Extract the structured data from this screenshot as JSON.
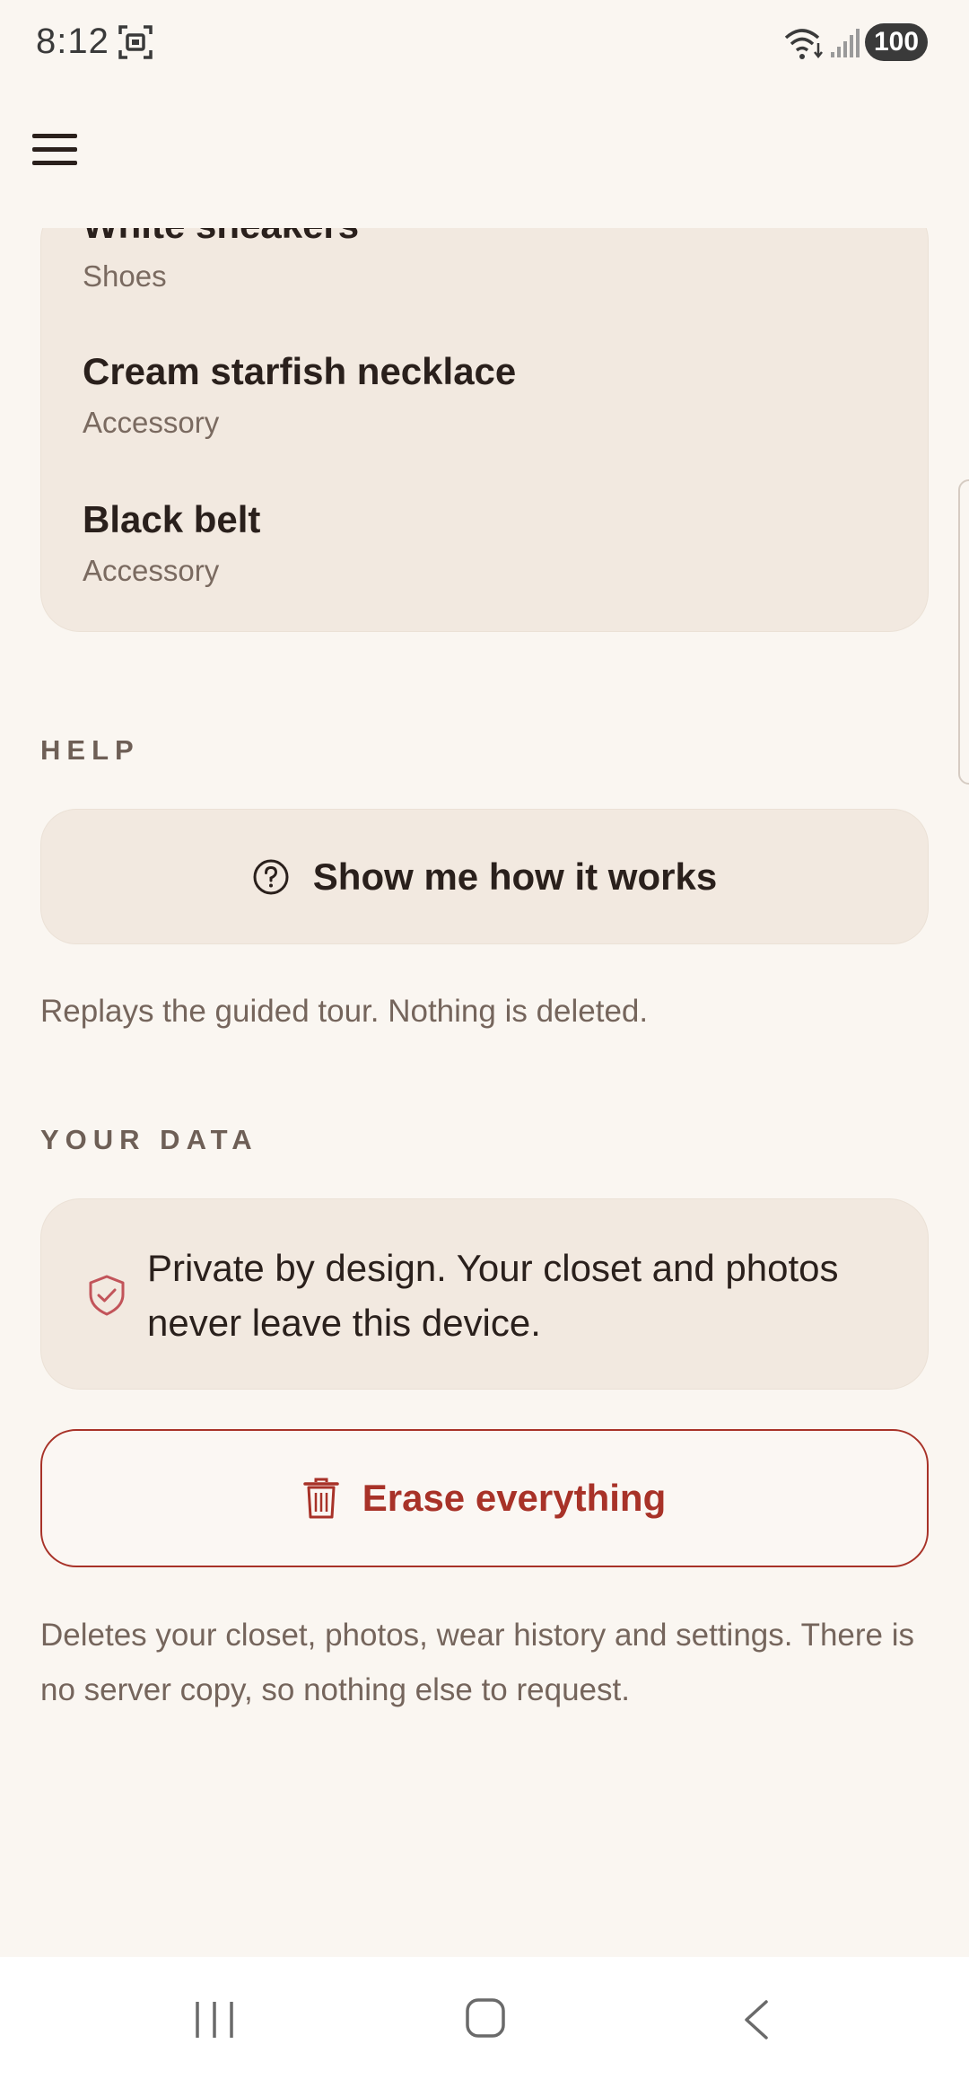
{
  "status_bar": {
    "time": "8:12",
    "battery": "100"
  },
  "app_bar": {
    "menu_icon": "hamburger-menu-icon"
  },
  "items": [
    {
      "name": "White sneakers",
      "category": "Shoes"
    },
    {
      "name": "Cream starfish necklace",
      "category": "Accessory"
    },
    {
      "name": "Black belt",
      "category": "Accessory"
    }
  ],
  "help": {
    "section_label": "HELP",
    "button_label": "Show me how it works",
    "button_icon": "help-circle-icon",
    "caption": "Replays the guided tour. Nothing is deleted."
  },
  "your_data": {
    "section_label": "YOUR DATA",
    "privacy_icon": "shield-check-icon",
    "privacy_text": "Private by design. Your closet and photos never leave this device.",
    "erase_label": "Erase everything",
    "erase_icon": "trash-icon",
    "erase_caption": "Deletes your closet, photos, wear history and settings. There is no server copy, so nothing else to request."
  },
  "colors": {
    "background": "#faf6f1",
    "card": "#f2e9e0",
    "danger": "#a83228",
    "text": "#2a201c",
    "muted": "#75655c"
  }
}
